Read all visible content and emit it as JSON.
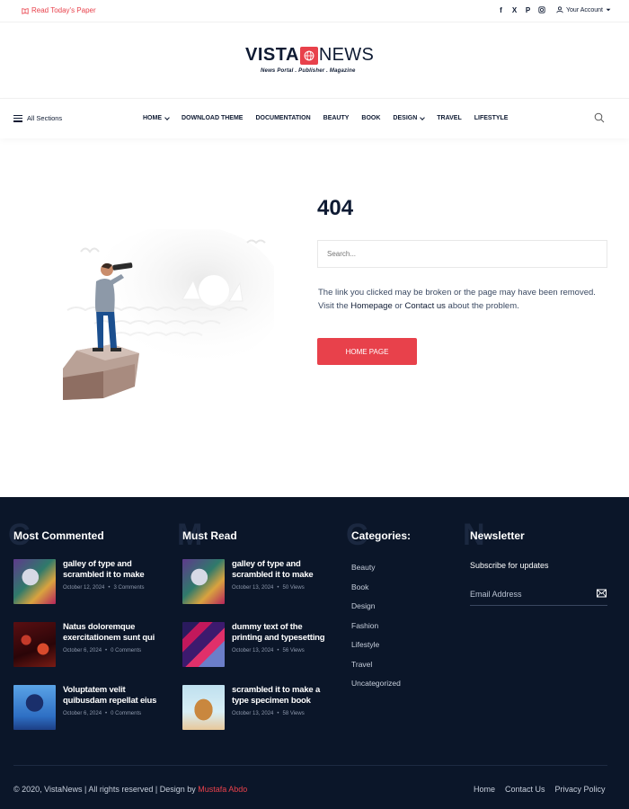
{
  "topbar": {
    "read_paper": "Read Today's Paper",
    "account": "Your Account",
    "socials": [
      "facebook-icon",
      "x-icon",
      "pinterest-icon",
      "instagram-icon"
    ]
  },
  "logo": {
    "part1": "VISTA",
    "part2": "NEWS",
    "tagline": "News Portal . Publisher . Magazine"
  },
  "nav": {
    "all_sections": "All Sections",
    "items": [
      "HOME",
      "DOWNLOAD THEME",
      "DOCUMENTATION",
      "BEAUTY",
      "BOOK",
      "DESIGN",
      "TRAVEL",
      "LIFESTYLE"
    ]
  },
  "error": {
    "code": "404",
    "search_placeholder": "Search...",
    "message_start": "The link you clicked may be broken or the page may have been removed. Visit the ",
    "homepage_link": "Homepage",
    "message_or": " or ",
    "contact_link": "Contact us",
    "message_end": " about the problem.",
    "button": "HOME PAGE"
  },
  "footer": {
    "most_commented": {
      "letter": "C",
      "title": "Most Commented",
      "posts": [
        {
          "title": "galley of type and scrambled it to make",
          "date": "October 12, 2024",
          "meta": "3 Comments"
        },
        {
          "title": "Natus doloremque exercitationem sunt qui",
          "date": "October 6, 2024",
          "meta": "0 Comments"
        },
        {
          "title": "Voluptatem velit quibusdam repellat eius",
          "date": "October 6, 2024",
          "meta": "0 Comments"
        }
      ]
    },
    "must_read": {
      "letter": "M",
      "title": "Must Read",
      "posts": [
        {
          "title": "galley of type and scrambled it to make",
          "date": "October 13, 2024",
          "meta": "50 Views"
        },
        {
          "title": "dummy text of the printing and typesetting",
          "date": "October 13, 2024",
          "meta": "56 Views"
        },
        {
          "title": "scrambled it to make a type specimen book",
          "date": "October 13, 2024",
          "meta": "58 Views"
        }
      ]
    },
    "categories": {
      "letter": "C",
      "title": "Categories:",
      "items": [
        "Beauty",
        "Book",
        "Design",
        "Fashion",
        "Lifestyle",
        "Travel",
        "Uncategorized"
      ]
    },
    "newsletter": {
      "letter": "N",
      "title": "Newsletter",
      "subscribe": "Subscribe for updates",
      "email_placeholder": "Email Address"
    },
    "copyright": "© 2020, VistaNews | All rights reserved | Design by ",
    "designer": "Mustafa Abdo",
    "links": [
      "Home",
      "Contact Us",
      "Privacy Policy"
    ]
  },
  "colors": {
    "accent": "#e8414b",
    "navy": "#0f1b33",
    "footer_bg": "#0b1629"
  }
}
